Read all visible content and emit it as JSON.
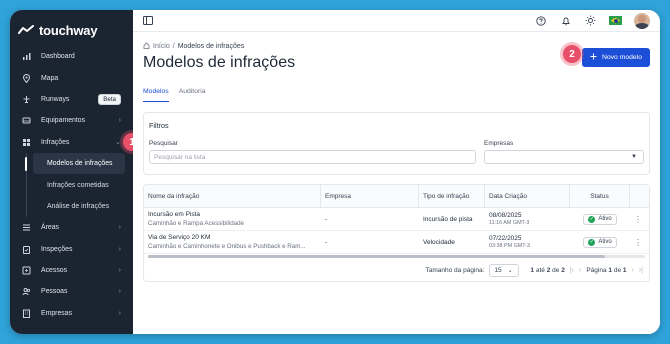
{
  "brand": {
    "name": "touchway"
  },
  "sidebar": {
    "items": [
      {
        "label": "Dashboard",
        "icon": "dashboard-icon"
      },
      {
        "label": "Mapa",
        "icon": "map-pin-icon"
      },
      {
        "label": "Runways",
        "icon": "runway-icon",
        "badge": "Beta"
      },
      {
        "label": "Equipamentos",
        "icon": "truck-icon"
      },
      {
        "label": "Infrações",
        "icon": "grid-icon"
      }
    ],
    "subitems": [
      {
        "label": "Modelos de infrações"
      },
      {
        "label": "Infrações cometidas"
      },
      {
        "label": "Análise de infrações"
      }
    ],
    "items_after": [
      {
        "label": "Áreas",
        "icon": "layers-icon"
      },
      {
        "label": "Inspeções",
        "icon": "clipboard-icon"
      },
      {
        "label": "Acessos",
        "icon": "key-icon"
      },
      {
        "label": "Pessoas",
        "icon": "users-icon"
      },
      {
        "label": "Empresas",
        "icon": "building-icon"
      }
    ]
  },
  "callouts": [
    "1",
    "2"
  ],
  "header": {
    "breadcrumb_home": "Início",
    "breadcrumb_sep": "/",
    "breadcrumb_current": "Modelos de infrações",
    "title": "Modelos de infrações",
    "new_button": "Novo modelo"
  },
  "tabs": [
    "Modelos",
    "Auditoria"
  ],
  "filters": {
    "title": "Filtros",
    "search_label": "Pesquisar",
    "search_placeholder": "Pesquisar na lista",
    "company_label": "Empresas"
  },
  "table": {
    "columns": [
      "Nome da infração",
      "Empresa",
      "Tipo de infração",
      "Data Criação",
      "Status"
    ],
    "rows": [
      {
        "name": "Incursão em Pista",
        "sub": "Caminhão e Rampa Acessibilidade",
        "company": "-",
        "type": "Incursão de pista",
        "date": "08/08/2025",
        "time": "11:16 AM GMT-3",
        "status": "Ativo"
      },
      {
        "name": "Via de Serviço 20 KM",
        "sub": "Caminhão e Caminhonete e Ônibus e Pushback e Ram...",
        "company": "-",
        "type": "Velocidade",
        "date": "07/22/2025",
        "time": "03:38 PM GMT-3",
        "status": "Ativo"
      }
    ]
  },
  "pagination": {
    "page_size_label": "Tamanho da página:",
    "page_size": "15",
    "range_start": "1",
    "range_sep": "até",
    "range_end": "2",
    "range_of": "de",
    "total": "2",
    "page_label": "Página",
    "page": "1",
    "page_of": "de",
    "pages": "1"
  },
  "colors": {
    "accent": "#1c4ed8",
    "sidebar_bg": "#1b2431",
    "callout": "#e8506a",
    "status_green": "#22a35a"
  }
}
